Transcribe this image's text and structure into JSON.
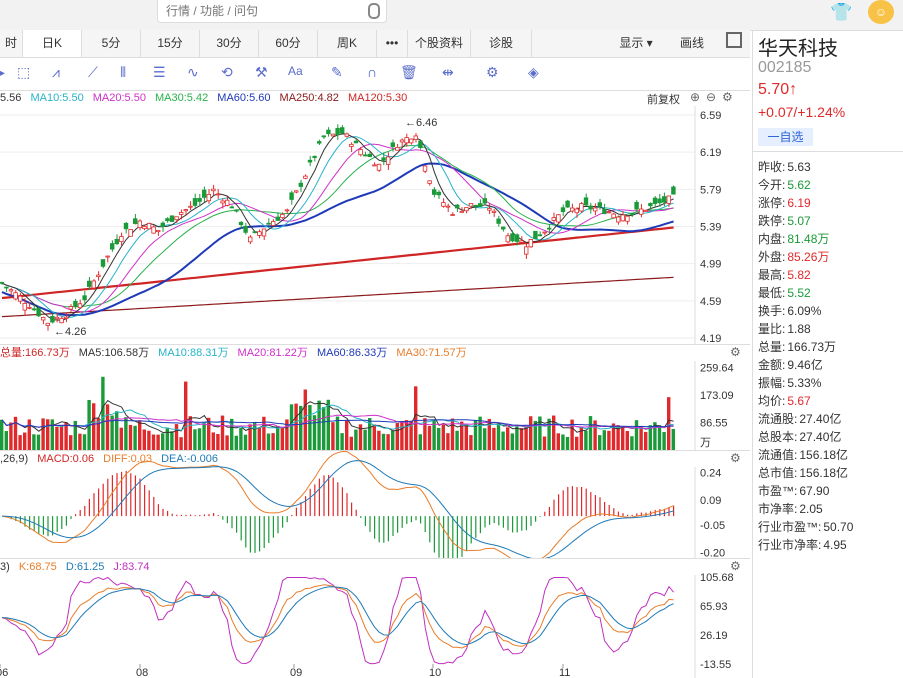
{
  "search": {
    "placeholder": "行情 / 功能 / 问句"
  },
  "tabs": [
    "时",
    "日K",
    "5分",
    "15分",
    "30分",
    "60分",
    "周K",
    "•••",
    "个股资料",
    "诊股"
  ],
  "tabs_right": [
    "显示 ▾",
    "画线"
  ],
  "main_legend": {
    "ma5": "5.56",
    "ma10": "MA10:5.50",
    "ma20": "MA20:5.50",
    "ma30": "MA30:5.42",
    "ma60": "MA60:5.60",
    "ma250": "MA250:4.82",
    "ma120": "MA120:5.30",
    "fq": "前复权"
  },
  "price_axis": [
    "6.59",
    "6.19",
    "5.79",
    "5.39",
    "4.99",
    "4.59",
    "4.19"
  ],
  "price_notes": {
    "high": "←6.46",
    "low": "←4.26"
  },
  "vol_legend": {
    "vol": "总量:166.73万",
    "ma5": "MA5:106.58万",
    "ma10": "MA10:88.31万",
    "ma20": "MA20:81.22万",
    "ma60": "MA60:86.33万",
    "ma30": "MA30:71.57万"
  },
  "vol_axis": [
    "259.64",
    "173.09",
    "86.55",
    "万"
  ],
  "macd_legend": {
    "param": ",26,9)",
    "macd": "MACD:0.06",
    "diff": "DIFF:0.03",
    "dea": "DEA:-0.006"
  },
  "macd_axis": [
    "0.24",
    "0.09",
    "-0.05",
    "-0.20"
  ],
  "kdj_legend": {
    "param": "3)",
    "k": "K:68.75",
    "d": "D:61.25",
    "j": "J:83.74"
  },
  "kdj_axis": [
    "105.68",
    "65.93",
    "26.19",
    "-13.55"
  ],
  "months": [
    "06",
    "08",
    "09",
    "10",
    "11"
  ],
  "stock": {
    "name": "华天科技",
    "code": "002185",
    "price": "5.70↑",
    "change": "+0.07/+1.24%",
    "watch": "一自选"
  },
  "quote": [
    {
      "k": "昨收:",
      "v": "5.63",
      "c": "#333"
    },
    {
      "k": "今开:",
      "v": "5.62",
      "c": "#1a9a38"
    },
    {
      "k": "涨停:",
      "v": "6.19",
      "c": "#e0292b"
    },
    {
      "k": "跌停:",
      "v": "5.07",
      "c": "#1a9a38"
    },
    {
      "k": "内盘:",
      "v": "81.48万",
      "c": "#1a9a38"
    },
    {
      "k": "外盘:",
      "v": "85.26万",
      "c": "#e0292b"
    },
    {
      "k": "最高:",
      "v": "5.82",
      "c": "#e0292b"
    },
    {
      "k": "最低:",
      "v": "5.52",
      "c": "#1a9a38"
    },
    {
      "k": "换手:",
      "v": "6.09%",
      "c": "#333"
    },
    {
      "k": "量比:",
      "v": "1.88",
      "c": "#333"
    },
    {
      "k": "总量:",
      "v": "166.73万",
      "c": "#333"
    },
    {
      "k": "金额:",
      "v": "9.46亿",
      "c": "#333"
    },
    {
      "k": "振幅:",
      "v": "5.33%",
      "c": "#333"
    },
    {
      "k": "均价:",
      "v": "5.67",
      "c": "#e0292b"
    },
    {
      "k": "流通股:",
      "v": "27.40亿",
      "c": "#333"
    },
    {
      "k": "总股本:",
      "v": "27.40亿",
      "c": "#333"
    },
    {
      "k": "流通值:",
      "v": "156.18亿",
      "c": "#333"
    },
    {
      "k": "总市值:",
      "v": "156.18亿",
      "c": "#333"
    },
    {
      "k": "市盈™:",
      "v": "67.90",
      "c": "#333"
    },
    {
      "k": "市净率:",
      "v": "2.05",
      "c": "#333"
    },
    {
      "k": "行业市盈™:",
      "v": "50.70",
      "c": "#333"
    },
    {
      "k": "行业市净率:",
      "v": "4.95",
      "c": "#333"
    }
  ]
}
